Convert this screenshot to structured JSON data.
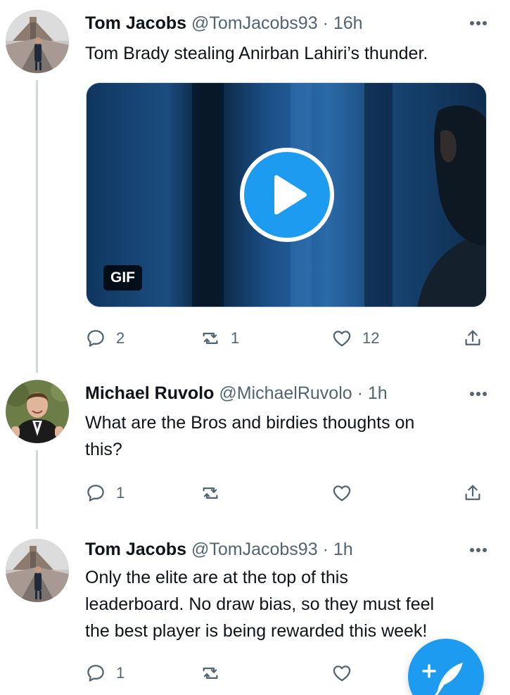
{
  "tweets": [
    {
      "display_name": "Tom Jacobs",
      "handle": "@TomJacobs93",
      "separator": "·",
      "time": "16h",
      "text": "Tom Brady stealing Anirban Lahiri’s thunder.",
      "media": {
        "badge": "GIF"
      },
      "actions": {
        "reply_count": "2",
        "retweet_count": "1",
        "like_count": "12"
      }
    },
    {
      "display_name": "Michael Ruvolo",
      "handle": "@MichaelRuvolo",
      "separator": "·",
      "time": "1h",
      "text_lines": [
        "What are the Bros and birdies thoughts on",
        "this?"
      ],
      "actions": {
        "reply_count": "1",
        "retweet_count": "",
        "like_count": ""
      }
    },
    {
      "display_name": "Tom Jacobs",
      "handle": "@TomJacobs93",
      "separator": "·",
      "time": "1h",
      "text_lines": [
        "Only the elite are at the top of this",
        "leaderboard. No draw bias, so they must feel",
        "the best player is being rewarded this week!"
      ],
      "actions": {
        "reply_count": "1",
        "retweet_count": "",
        "like_count": ""
      }
    }
  ],
  "colors": {
    "accent": "#1d9bf0",
    "secondary_text": "#536471",
    "thread_line": "#cfd9de"
  },
  "icons": [
    "more-icon",
    "reply-icon",
    "retweet-icon",
    "like-icon",
    "share-icon",
    "play-icon",
    "compose-feather-icon"
  ]
}
